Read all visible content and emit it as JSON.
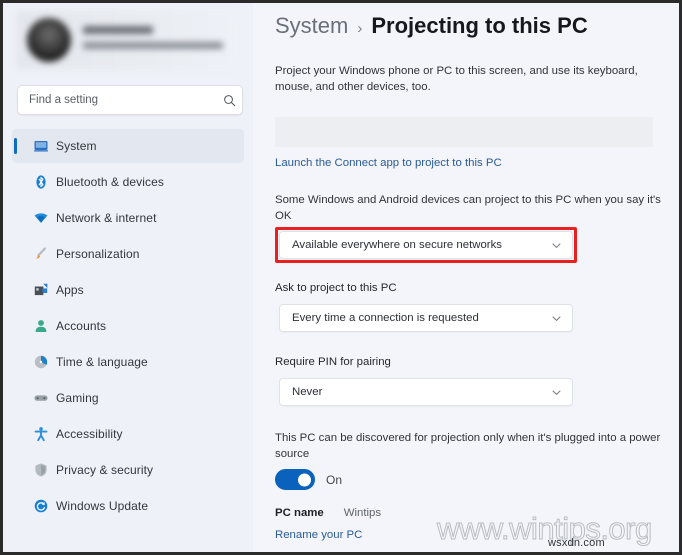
{
  "window": {
    "accent_color": "#0b62bc",
    "link_color": "#2a5b96",
    "highlight_color": "#e8201f",
    "sidebar_bg": "#eef1f7",
    "content_bg": "#f3f5fa"
  },
  "sidebar": {
    "search": {
      "placeholder": "Find a setting",
      "value": "",
      "icon": "search-icon"
    },
    "profile": {
      "blurred": true,
      "avatar_icon": "avatar"
    },
    "items": [
      {
        "label": "System",
        "icon": "monitor-icon",
        "active": true
      },
      {
        "label": "Bluetooth & devices",
        "icon": "bluetooth-icon",
        "active": false
      },
      {
        "label": "Network & internet",
        "icon": "wifi-icon",
        "active": false
      },
      {
        "label": "Personalization",
        "icon": "paintbrush-icon",
        "active": false
      },
      {
        "label": "Apps",
        "icon": "apps-icon",
        "active": false
      },
      {
        "label": "Accounts",
        "icon": "person-icon",
        "active": false
      },
      {
        "label": "Time & language",
        "icon": "clock-icon",
        "active": false
      },
      {
        "label": "Gaming",
        "icon": "gamepad-icon",
        "active": false
      },
      {
        "label": "Accessibility",
        "icon": "accessibility-icon",
        "active": false
      },
      {
        "label": "Privacy & security",
        "icon": "shield-icon",
        "active": false
      },
      {
        "label": "Windows Update",
        "icon": "update-icon",
        "active": false
      }
    ]
  },
  "main": {
    "breadcrumb": {
      "parent": "System",
      "separator": "›",
      "current": "Projecting to this PC"
    },
    "subtitle": "Project your Windows phone or PC to this screen, and use its keyboard, mouse, and other devices, too.",
    "connect_link": "Launch the Connect app to project to this PC",
    "settings": [
      {
        "description": "Some Windows and Android devices can project to this PC when you say it's OK",
        "value": "Available everywhere on secure networks",
        "highlighted": true
      },
      {
        "label": "Ask to project to this PC",
        "value": "Every time a connection is requested",
        "highlighted": false
      },
      {
        "label": "Require PIN for pairing",
        "value": "Never",
        "highlighted": false
      }
    ],
    "power_setting": {
      "description": "This PC can be discovered for projection only when it's plugged into a power source",
      "toggle_state": "On",
      "toggle_on": true
    },
    "pc_name": {
      "label": "PC name",
      "value": "Wintips",
      "rename_link": "Rename your PC"
    }
  },
  "watermarks": {
    "primary": "www.wintips.org",
    "secondary": "wsxdn.com"
  }
}
